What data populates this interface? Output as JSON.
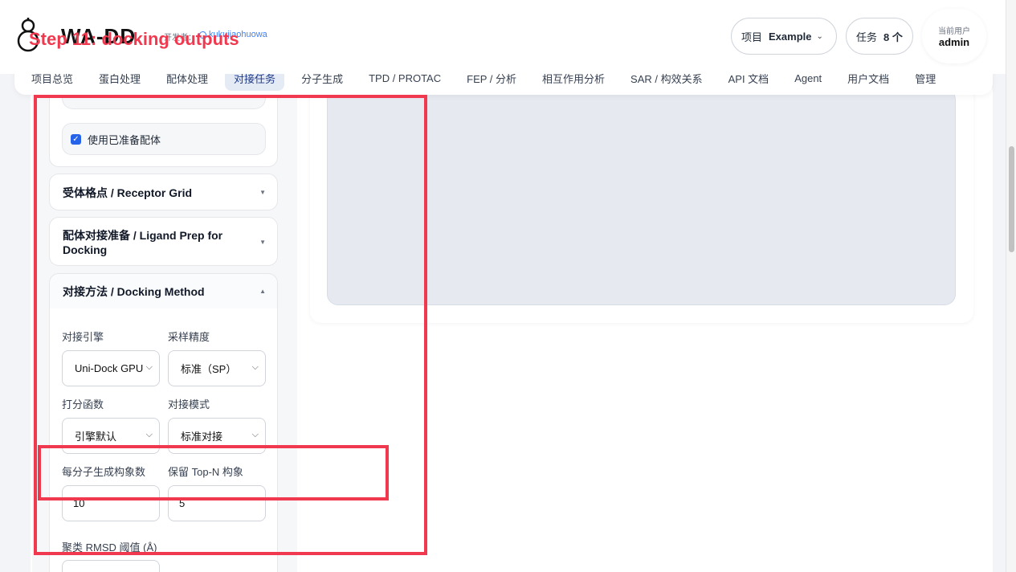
{
  "annotation": {
    "step_text": "Step 11: docking outputs"
  },
  "header": {
    "brand": "WA-DD",
    "developer_label": "开发者：",
    "developer_name": "kukujiaohuowa",
    "project_label": "项目",
    "project_value": "Example",
    "tasks_label": "任务",
    "tasks_value": "8 个",
    "user_label": "当前用户",
    "user_name": "admin"
  },
  "nav": {
    "tabs": [
      {
        "label": "项目总览"
      },
      {
        "label": "蛋白处理"
      },
      {
        "label": "配体处理"
      },
      {
        "label": "对接任务",
        "active": true
      },
      {
        "label": "分子生成"
      },
      {
        "label": "TPD / PROTAC"
      },
      {
        "label": "FEP / 分析"
      },
      {
        "label": "相互作用分析"
      },
      {
        "label": "SAR / 构效关系"
      },
      {
        "label": "API 文档"
      },
      {
        "label": "Agent"
      },
      {
        "label": "用户文档"
      },
      {
        "label": "管理"
      }
    ]
  },
  "left_panel": {
    "use_prepared_ligand": {
      "label": "使用已准备配体",
      "checked": true
    },
    "sections": {
      "receptor_grid": "受体格点 / Receptor Grid",
      "ligand_prep": "配体对接准备 / Ligand Prep for Docking",
      "docking_method": "对接方法 / Docking Method"
    },
    "method": {
      "engine_label": "对接引擎",
      "engine_value": "Uni-Dock GPU",
      "precision_label": "采样精度",
      "precision_value": "标准（SP）",
      "scoring_label": "打分函数",
      "scoring_value": "引擎默认",
      "mode_label": "对接模式",
      "mode_value": "标准对接",
      "poses_label": "每分子生成构象数",
      "poses_value": "10",
      "topn_label": "保留 Top-N 构象",
      "topn_value": "5",
      "rmsd_label": "聚类 RMSD 阈值 (Å)"
    }
  },
  "colors": {
    "accent": "#2563eb",
    "annotation": "#f0394f",
    "active_tab_bg": "#e5ebf5"
  }
}
